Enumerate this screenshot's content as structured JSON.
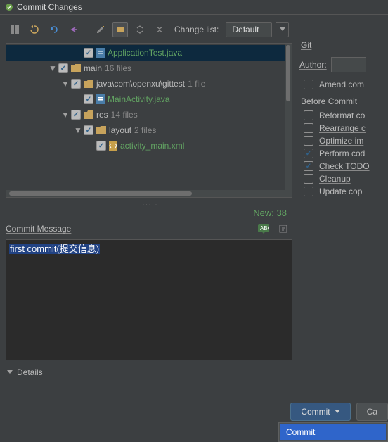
{
  "title": "Commit Changes",
  "toolbar": {
    "change_list_label": "Change list:",
    "change_list_value": "Default"
  },
  "tree": {
    "items": [
      {
        "indent": 5,
        "sel": true,
        "chev": "",
        "icon": "java",
        "name": "ApplicationTest.java",
        "cls": "fname-java",
        "count": ""
      },
      {
        "indent": 3,
        "sel": false,
        "chev": "▼",
        "icon": "folder",
        "name": "main",
        "cls": "fname-res",
        "count": "16 files"
      },
      {
        "indent": 4,
        "sel": false,
        "chev": "▼",
        "icon": "folder",
        "name": "java\\com\\openxu\\gittest",
        "cls": "fname-res",
        "count": "1 file"
      },
      {
        "indent": 5,
        "sel": false,
        "chev": "",
        "icon": "java",
        "name": "MainActivity.java",
        "cls": "fname-java",
        "count": ""
      },
      {
        "indent": 4,
        "sel": false,
        "chev": "▼",
        "icon": "folder",
        "name": "res",
        "cls": "fname-res",
        "count": "14 files"
      },
      {
        "indent": 5,
        "sel": false,
        "chev": "▼",
        "icon": "folder",
        "name": "layout",
        "cls": "fname-res",
        "count": "2 files"
      },
      {
        "indent": 6,
        "sel": false,
        "chev": "",
        "icon": "xml",
        "name": "activity_main.xml",
        "cls": "fname-java",
        "count": ""
      }
    ],
    "new_count": "New: 38"
  },
  "commit_message": {
    "label": "Commit Message",
    "text": "first commit(提交信息)"
  },
  "details_label": "Details",
  "vcs": {
    "label": "Git",
    "author_label": "Author:",
    "amend_label": "Amend com"
  },
  "before_commit": {
    "title": "Before Commit",
    "options": [
      {
        "label": "Reformat co",
        "checked": false
      },
      {
        "label": "Rearrange c",
        "checked": false
      },
      {
        "label": "Optimize im",
        "checked": false
      },
      {
        "label": "Perform cod",
        "checked": true
      },
      {
        "label": "Check TODO",
        "checked": true
      },
      {
        "label": "Cleanup",
        "checked": false
      },
      {
        "label": "Update cop",
        "checked": false
      }
    ]
  },
  "buttons": {
    "commit": "Commit",
    "cancel": "Ca",
    "dropdown_item": "Commit"
  }
}
